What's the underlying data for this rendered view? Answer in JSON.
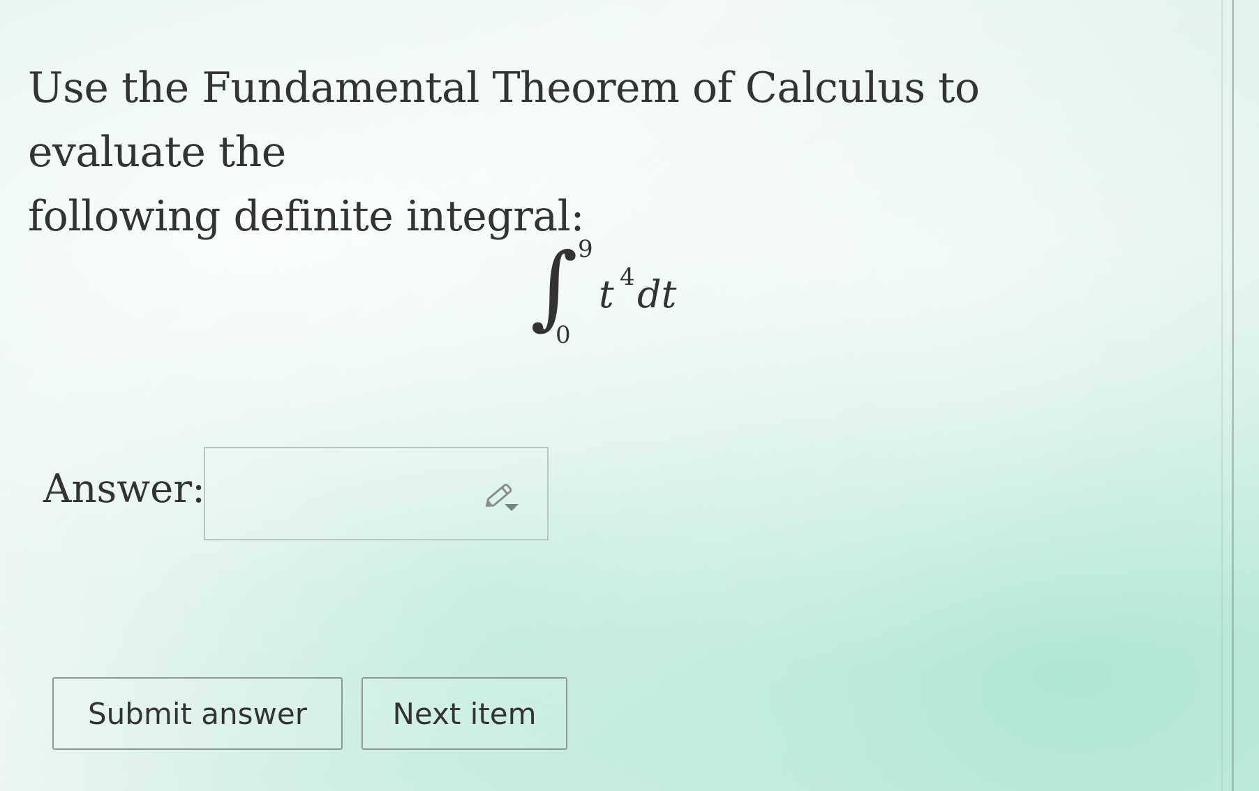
{
  "question": {
    "text_line1": "Use the Fundamental Theorem of Calculus to evaluate the",
    "text_line2": "following definite integral:"
  },
  "integral": {
    "symbol": "∫",
    "upper_limit": "9",
    "lower_limit": "0",
    "integrand_base": "t",
    "integrand_exponent": "4",
    "differential": "dt"
  },
  "answer": {
    "label": "Answer:",
    "value": "",
    "tool_icon": "pencil-dropdown-icon"
  },
  "buttons": {
    "submit_label": "Submit answer",
    "next_label": "Next item"
  },
  "colors": {
    "text": "#333333",
    "border": "#b9c4bf",
    "button_border": "#8f9893"
  }
}
